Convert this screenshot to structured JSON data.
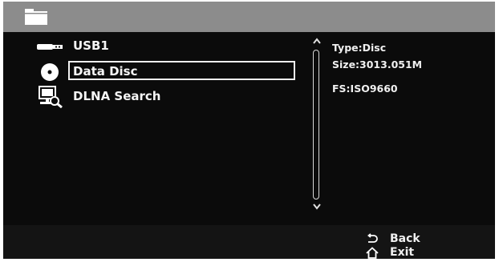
{
  "header": {
    "icon": "folder-icon"
  },
  "sources": [
    {
      "label": "USB1",
      "icon": "usb-stick-icon",
      "selected": false
    },
    {
      "label": "Data Disc",
      "icon": "disc-icon",
      "selected": true
    },
    {
      "label": "DLNA Search",
      "icon": "network-search-icon",
      "selected": false
    }
  ],
  "details": {
    "type": "Type:Disc",
    "size": "Size:3013.051M",
    "fs": "FS:ISO9660"
  },
  "footer": {
    "back_label": "Back",
    "exit_label": "Exit"
  },
  "colors": {
    "titlebar": "#8c8c8c",
    "background": "#0b0b0b",
    "text": "#f0f0f0"
  }
}
